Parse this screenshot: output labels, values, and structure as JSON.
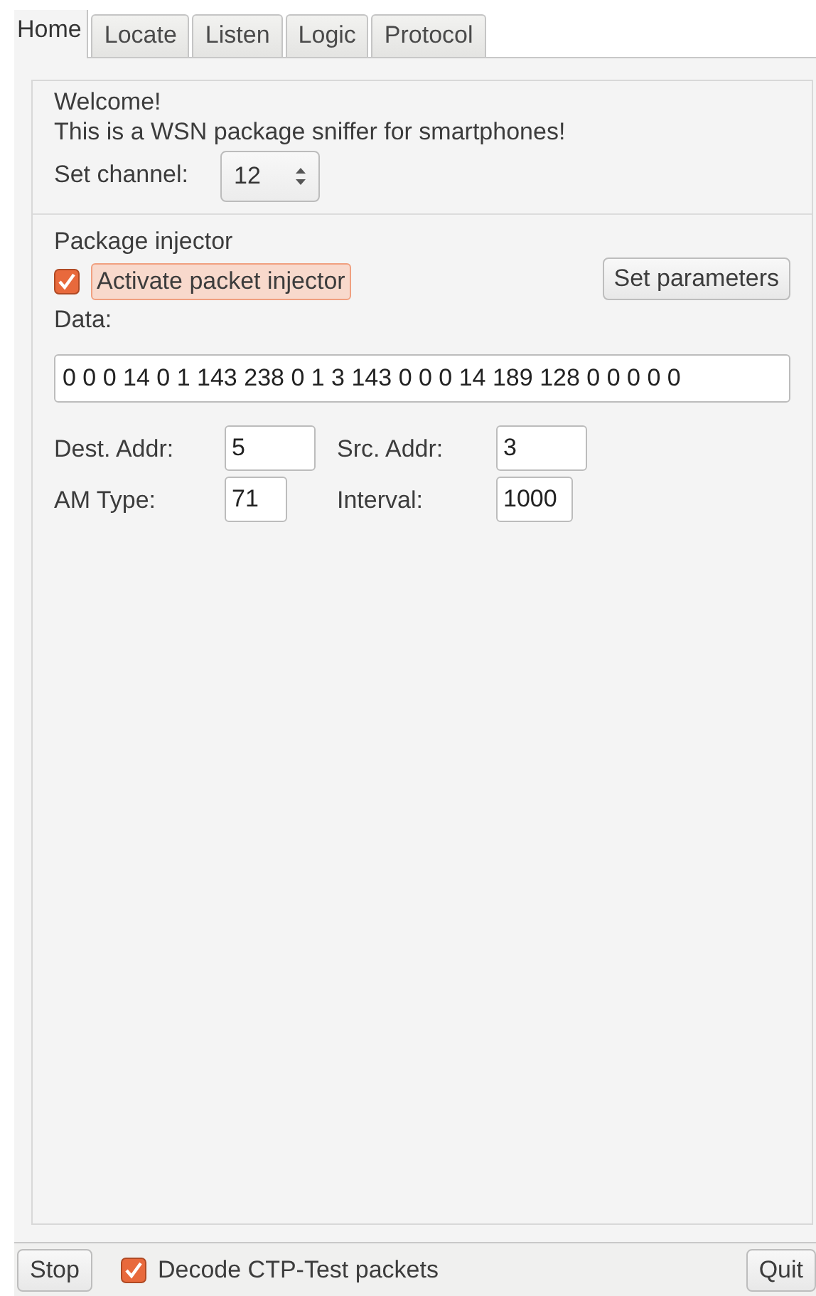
{
  "tabs": [
    {
      "label": "Home",
      "selected": true
    },
    {
      "label": "Locate",
      "selected": false
    },
    {
      "label": "Listen",
      "selected": false
    },
    {
      "label": "Logic",
      "selected": false
    },
    {
      "label": "Protocol",
      "selected": false
    }
  ],
  "welcome": {
    "title": "Welcome!",
    "text": "This is a WSN package sniffer for smartphones!",
    "channel_label": "Set channel:",
    "channel_value": "12"
  },
  "injector": {
    "title": "Package injector",
    "activate": {
      "label": "Activate packet injector",
      "checked": true,
      "focused": true
    },
    "set_parameters_button": "Set parameters",
    "data_label": "Data:",
    "data_value": "0 0 0 14 0 1 143 238 0 1 3 143 0 0 0 14 189 128 0 0 0 0 0",
    "fields": [
      {
        "label": "Dest. Addr:",
        "value": "5"
      },
      {
        "label": "Src. Addr:",
        "value": "3"
      },
      {
        "label": "AM Type:",
        "value": "71"
      },
      {
        "label": "Interval:",
        "value": "1000"
      }
    ]
  },
  "bottom_bar": {
    "stop_button": "Stop",
    "decode": {
      "label": "Decode CTP-Test packets",
      "checked": true
    },
    "quit_button": "Quit"
  }
}
